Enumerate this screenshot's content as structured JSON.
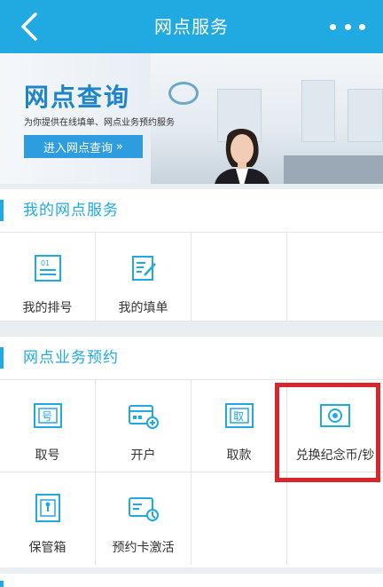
{
  "header": {
    "title": "网点服务"
  },
  "banner": {
    "title": "网点查询",
    "subtitle": "为你提供在线填单、网点业务预约服务",
    "button_label": "进入网点查询",
    "button_arrow": "»"
  },
  "my_services": {
    "title": "我的网点服务",
    "items": [
      {
        "label": "我的排号",
        "icon": "queue-ticket-icon"
      },
      {
        "label": "我的填单",
        "icon": "form-edit-icon"
      },
      {
        "label": "",
        "icon": ""
      },
      {
        "label": "",
        "icon": ""
      }
    ]
  },
  "appointments": {
    "title": "网点业务预约",
    "items": [
      {
        "label": "取号",
        "icon": "number-ticket-icon"
      },
      {
        "label": "开户",
        "icon": "open-account-card-icon"
      },
      {
        "label": "取款",
        "icon": "withdraw-icon"
      },
      {
        "label": "兑换纪念币/钞",
        "icon": "commemorative-coin-icon"
      },
      {
        "label": "保管箱",
        "icon": "safe-box-icon"
      },
      {
        "label": "预约卡激活",
        "icon": "card-activation-icon"
      }
    ]
  },
  "colors": {
    "brand": "#21a9e1",
    "highlight": "#d6282c"
  }
}
